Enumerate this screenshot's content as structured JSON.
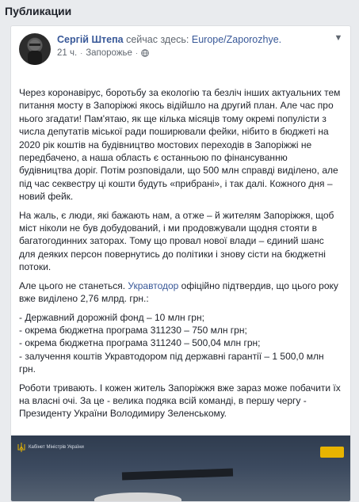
{
  "section": {
    "title": "Публикации"
  },
  "post": {
    "author": "Сергій Штепа",
    "checkin_text": "сейчас здесь:",
    "place": "Europe/Zaporozhye.",
    "time": "21 ч.",
    "location": "Запорожье",
    "paragraph1": "Через коронавірус, боротьбу за екологію та безліч інших актуальних тем питання мосту в Запоріжжі якось відійшло на другий план. Але час про нього згадати! Пам'ятаю, як ще кілька місяців тому окремі популісти з числа депутатів міської ради поширювали фейки, нібито в бюджеті на 2020 рік коштів на будівництво мостових переходів в Запоріжжі не передбачено, а наша область є останньою по фінансуванню будівництва доріг. Потім розповідали, що 500 млн справді виділено, але під час секвестру ці кошти будуть «прибрані», і так далі. Кожного дня – новий фейк.",
    "paragraph2": "На жаль, є люди, які бажають нам, а отже – й жителям Запоріжжя, щоб міст ніколи не був добудований, і ми продовжували щодня стояти в багатогодинних заторах. Тому що провал нової влади – єдиний шанс для деяких персон повернутись до політики і знову сісти на бюджетні потоки.",
    "p3_before": "Але цього не станеться. ",
    "p3_link": "Укравтодор",
    "p3_after": " офіційно підтвердив, що цього року вже виділено 2,76 млрд. грн.:",
    "list": [
      "- Державний дорожній фонд – 10 млн грн;",
      "- окрема бюджетна програма 311230 – 750 млн грн;",
      "- окрема бюджетна програма 311240 – 500,04 млн грн;",
      "- залучення коштів Укравтодором під державні гарантії – 1 500,0 млн грн."
    ],
    "paragraph4": "Роботи тривають. І кожен житель Запоріжжя вже зараз може побачити їх на власні очі. За це - велика подяка всій команді, в першу чергу - Президенту України Володимиру Зеленському.",
    "image_logo_text": "Кабінет Міністрів України"
  },
  "colors": {
    "link": "#385898",
    "text": "#1d2129",
    "muted": "#606770",
    "bg": "#e9ebee"
  },
  "icons": {
    "more": "chevron-down-icon",
    "privacy": "globe-icon"
  }
}
